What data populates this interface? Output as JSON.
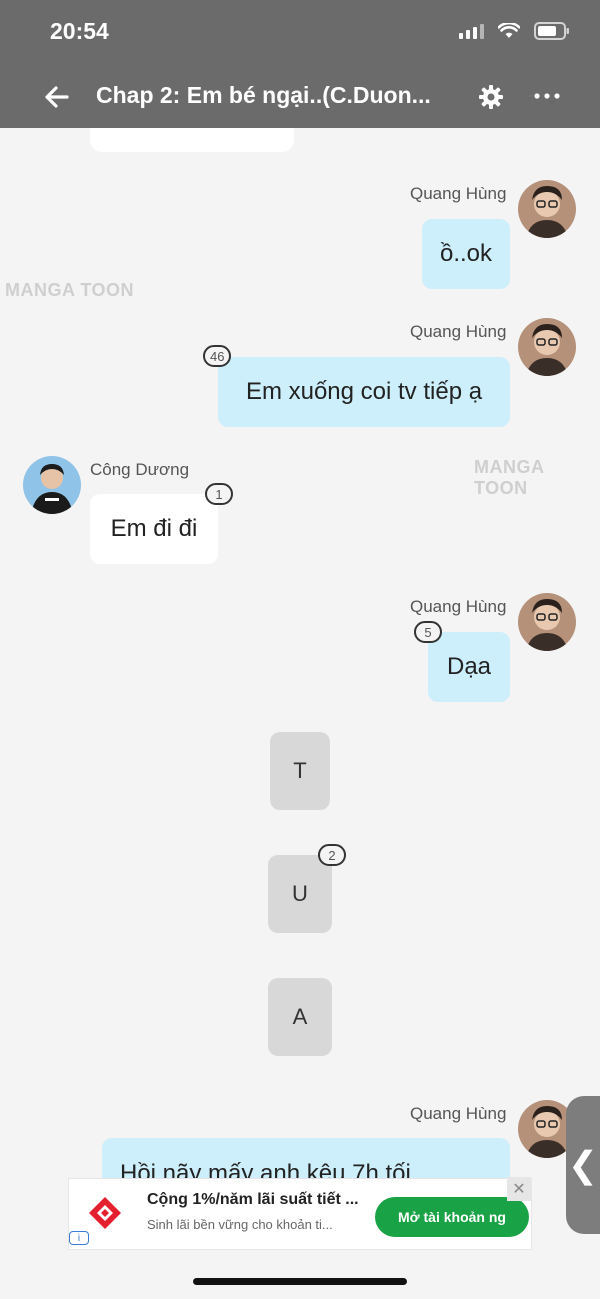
{
  "status_bar": {
    "time": "20:54"
  },
  "header": {
    "title": "Chap 2: Em bé ngại..(C.Duon..."
  },
  "watermark_text": "MANGA TOON",
  "messages": [
    {
      "sender": "Quang Hùng",
      "text": "ồ..ok"
    },
    {
      "sender": "Quang Hùng",
      "text": "Em xuống coi tv tiếp ạ",
      "badge": "46"
    },
    {
      "sender": "Công Dương",
      "text": "Em đi đi",
      "badge": "1"
    },
    {
      "sender": "Quang Hùng",
      "text": "Dạa",
      "badge": "5"
    },
    {
      "text": "T"
    },
    {
      "text": "U",
      "badge": "2"
    },
    {
      "text": "A"
    },
    {
      "sender": "Quang Hùng",
      "text": "Hồi nãy mấy anh kêu 7h tối"
    }
  ],
  "side_handle": {
    "label": "❮"
  },
  "ad": {
    "title": "Cộng 1%/năm lãi suất tiết ...",
    "subtitle": "Sinh lãi bền vững cho khoản ti...",
    "cta": "Mở tài khoản ng",
    "close": "✕",
    "info": "i",
    "brand_color": "#e5202e"
  },
  "colors": {
    "header_bg": "#6b6b6b",
    "bubble_blue": "#cdeefb",
    "cta_green": "#1aa246"
  }
}
